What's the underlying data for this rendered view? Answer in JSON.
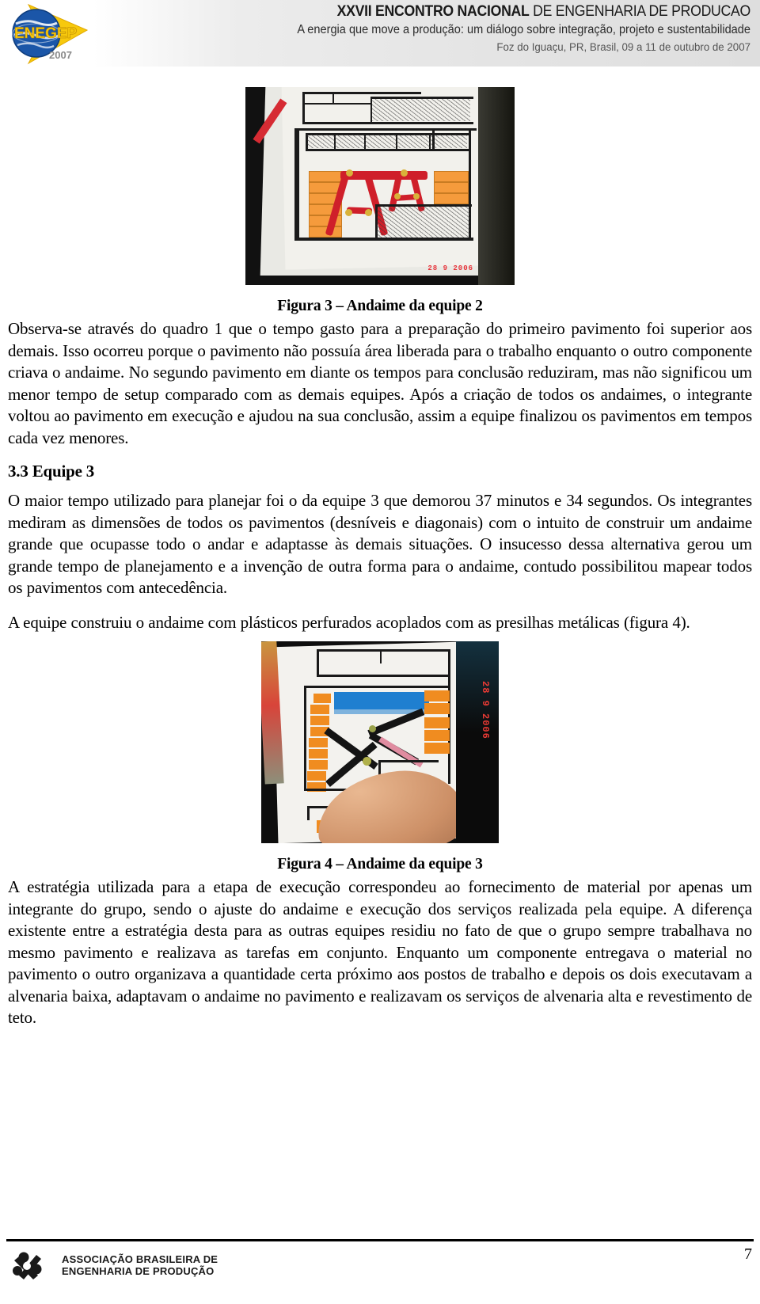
{
  "header": {
    "logo_alt": "ENEGEP 2007",
    "logo_word": "ENEGEP",
    "logo_year": "2007",
    "title_bold": "XXVII ENCONTRO NACIONAL",
    "title_rest": " DE ENGENHARIA DE PRODUCAO",
    "subtitle": "A energia que move a produção: um diálogo sobre integração, projeto e sustentabilidade",
    "location": "Foz do Iguaçu, PR, Brasil,  09 a 11 de outubro de 2007"
  },
  "figure3": {
    "caption": "Figura 3 – Andaime da equipe 2",
    "date_stamp": "28  9  2006"
  },
  "figure4": {
    "caption": "Figura 4 – Andaime da equipe 3",
    "date_stamp": "28 9 2006"
  },
  "body": {
    "p1": "Observa-se através do quadro 1 que o tempo gasto para a preparação do primeiro pavimento foi superior aos demais. Isso ocorreu porque o pavimento não possuía área liberada para o trabalho enquanto o outro componente criava o andaime. No segundo pavimento em diante os tempos para conclusão reduziram, mas não significou um menor tempo de setup comparado com as demais equipes. Após a criação de todos os andaimes, o integrante voltou ao pavimento em execução e ajudou na sua conclusão, assim a equipe finalizou os pavimentos em tempos cada vez menores.",
    "section_title": "3.3 Equipe 3",
    "p2": "O maior tempo utilizado para planejar foi o da equipe 3 que demorou 37 minutos e 34 segundos. Os integrantes mediram as dimensões de todos os pavimentos (desníveis e diagonais) com o intuito de construir um andaime grande que ocupasse todo o andar e adaptasse às demais situações. O insucesso dessa alternativa gerou um grande tempo de planejamento e a invenção de outra forma para o andaime, contudo possibilitou mapear todos os pavimentos com antecedência.",
    "p3": "A equipe construiu o andaime com plásticos perfurados acoplados com as presilhas metálicas (figura 4).",
    "p4": "A estratégia utilizada para a etapa de execução correspondeu ao fornecimento de material por apenas um integrante do grupo, sendo o ajuste do andaime e execução dos serviços realizada pela equipe. A diferença existente entre a estratégia desta para as outras equipes residiu no fato de que o grupo sempre trabalhava no mesmo pavimento e realizava as tarefas em conjunto. Enquanto um componente entregava o material no pavimento o outro organizava a quantidade certa próximo aos postos de trabalho e depois os dois executavam a alvenaria baixa, adaptavam o andaime no pavimento e realizavam os serviços de alvenaria alta e revestimento de teto."
  },
  "footer": {
    "org_line1": "ASSOCIAÇÃO BRASILEIRA DE",
    "org_line2": "ENGENHARIA DE PRODUÇÃO",
    "page_number": "7"
  },
  "colors": {
    "accent_red": "#cf1f2a",
    "brick_orange": "#f59b3c",
    "logo_yellow": "#f6c413",
    "logo_blue": "#1c55a5"
  }
}
